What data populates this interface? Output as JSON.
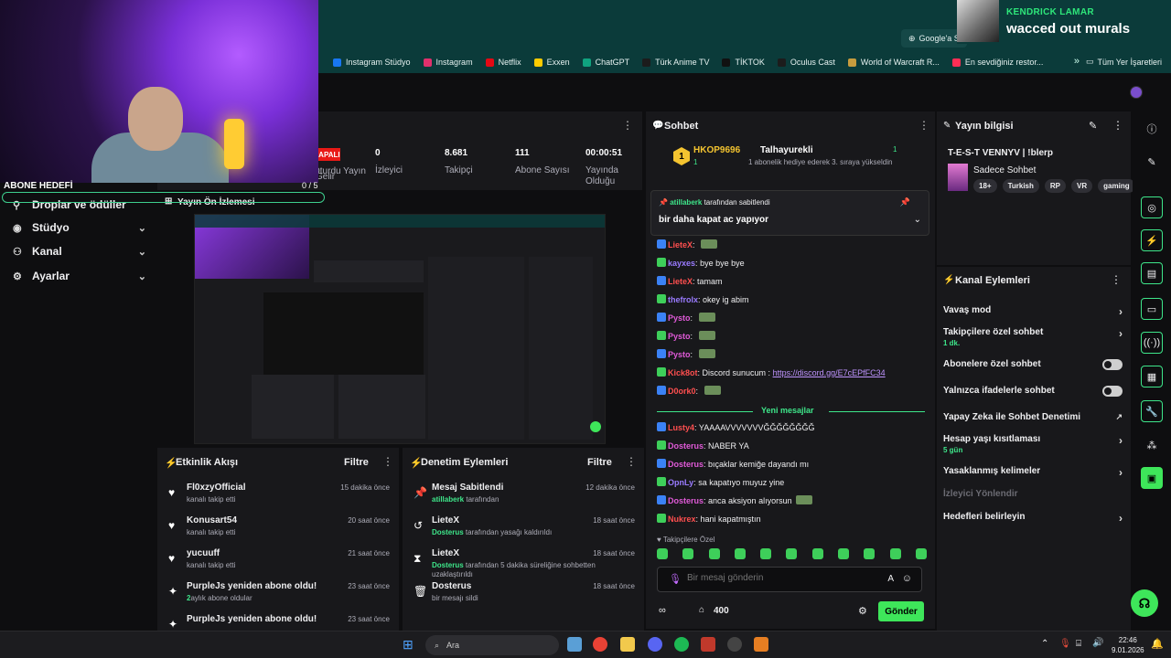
{
  "browser": {
    "bookmarks": [
      {
        "label": "Instagram Stüdyo",
        "color": "#1877f2"
      },
      {
        "label": "Instagram",
        "color": "#e1306c"
      },
      {
        "label": "Netflix",
        "color": "#e50914"
      },
      {
        "label": "Exxen",
        "color": "#ffcc00"
      },
      {
        "label": "ChatGPT",
        "color": "#10a37f"
      },
      {
        "label": "Türk Anime TV",
        "color": "#1c1c1c"
      },
      {
        "label": "TİKTOK",
        "color": "#111111"
      },
      {
        "label": "Oculus Cast",
        "color": "#1c1c1c"
      },
      {
        "label": "World of Warcraft R...",
        "color": "#c79c3e"
      },
      {
        "label": "En sevdiğiniz restor...",
        "color": "#ff2e55"
      }
    ],
    "more": "»",
    "all_bookmarks": "Tüm Yer İşaretleri",
    "google_pill": "Google'a S"
  },
  "now_playing": {
    "artist": "KENDRICK LAMAR",
    "track": "wacced out murals"
  },
  "goal": {
    "label": "ABONE HEDEFİ",
    "count": "0 / 5"
  },
  "nav": {
    "drops": "Droplar ve ödüller",
    "preview": "Yayın Ön İzlemesi",
    "items": [
      {
        "label": "Stüdyo"
      },
      {
        "label": "Kanal"
      },
      {
        "label": "Ayarlar"
      }
    ]
  },
  "stats": {
    "live_badge": "KAPALI",
    "cut_label": "Gelir",
    "items": [
      {
        "value": "",
        "label": "Oturdu Yayın"
      },
      {
        "value": "0",
        "label": "İzleyici"
      },
      {
        "value": "8.681",
        "label": "Takipçi"
      },
      {
        "value": "111",
        "label": "Abone Sayısı"
      },
      {
        "value": "00:00:51",
        "label": "Yayında Olduğu"
      }
    ]
  },
  "activity": {
    "title": "Etkinlik Akışı",
    "filter": "Filtre",
    "events": [
      {
        "title": "Fl0xzyOfficial",
        "sub": "kanalı takip etti",
        "time": "15 dakika önce"
      },
      {
        "title": "Konusart54",
        "sub": "kanalı takip etti",
        "time": "20 saat önce"
      },
      {
        "title": "yucuuff",
        "sub": "kanalı takip etti",
        "time": "21 saat önce"
      },
      {
        "title": "PurpleJs yeniden abone oldu!",
        "sub_bold": "2",
        "sub": "aylık abone oldular",
        "time": "23 saat önce"
      },
      {
        "title": "PurpleJs yeniden abone oldu!",
        "sub": "",
        "time": "23 saat önce"
      }
    ]
  },
  "moderation": {
    "title": "Denetim Eylemleri",
    "filter": "Filtre",
    "events": [
      {
        "title": "Mesaj Sabitlendi",
        "actor": "atillaberk",
        "sub": "tarafından",
        "time": "12 dakika önce"
      },
      {
        "title": "LieteX",
        "actor": "Dosterus",
        "sub": "tarafından yasağı kaldırıldı",
        "time": "18 saat önce"
      },
      {
        "title": "LieteX",
        "actor": "Dosterus",
        "sub": "tarafından 5 dakika süreliğine sohbetten uzaklaştırıldı",
        "time": "18 saat önce"
      },
      {
        "title": "Dosterus",
        "actor": "",
        "sub": "bir mesajı sildi",
        "time": "18 saat önce"
      }
    ]
  },
  "chat": {
    "title": "Sohbet",
    "hype": {
      "rank": "1",
      "name": "HKOP9696",
      "name2": "Talhayurekli",
      "num": "1",
      "count": "1",
      "sub": "1 abonelik hediye ederek 3. sıraya yükseldin"
    },
    "pinned_by_user": "atillaberk",
    "pinned_by_rest": "tarafından sabitlendi",
    "pinned_msg": "bir daha kapat ac yapıyor",
    "messages": [
      {
        "user": "LieteX",
        "color": "#ff4f4f",
        "text": "",
        "emote": true
      },
      {
        "user": "kayxes",
        "color": "#9a7bff",
        "text": "bye bye bye"
      },
      {
        "user": "LieteX",
        "color": "#ff4f4f",
        "text": "tamam"
      },
      {
        "user": "thefrolx",
        "color": "#9a7bff",
        "text": "okey ig abim"
      },
      {
        "user": "Pysto",
        "color": "#e05ad8",
        "text": "",
        "emote": true
      },
      {
        "user": "Pysto",
        "color": "#e05ad8",
        "text": "",
        "emote": true
      },
      {
        "user": "Pysto",
        "color": "#e05ad8",
        "text": "",
        "emote": true
      },
      {
        "user": "Kick8ot",
        "color": "#ff4f4f",
        "text": "Discord sunucum : ",
        "link": "https://discord.gg/E7cEPfFC34"
      },
      {
        "user": "D0ork0",
        "color": "#ff4f4f",
        "text": "",
        "emote": true
      }
    ],
    "new_label": "Yeni mesajlar",
    "messages2": [
      {
        "user": "Lusty4",
        "color": "#ff4f4f",
        "text": "YAAAAVVVVVVVĞĞĞĞĞĞĞĞ"
      },
      {
        "user": "Dosterus",
        "color": "#e05ad8",
        "text": "NABER YA"
      },
      {
        "user": "Dosterus",
        "color": "#e05ad8",
        "text": "bıçaklar kemiğe dayandı mı"
      },
      {
        "user": "OpnLy",
        "color": "#9a7bff",
        "text": "sa kapatıyo muyuz yine"
      },
      {
        "user": "Dosterus",
        "color": "#e05ad8",
        "text": "anca aksiyon alıyorsun",
        "emote": true
      },
      {
        "user": "Nukrex",
        "color": "#ff4f4f",
        "text": "hani kapatmıştın"
      }
    ],
    "followers_only": "Takipçilere Özel",
    "input_placeholder": "Bir mesaj gönderin",
    "points": "400",
    "send": "Gönder"
  },
  "info": {
    "title": "Yayın bilgisi",
    "stream_title": "T-E-S-T  VENNYV | !blerp",
    "category": "Sadece Sohbet",
    "tags": [
      "18+",
      "Turkish",
      "RP",
      "VR",
      "gaming"
    ]
  },
  "actions": {
    "title": "Kanal Eylemleri",
    "items": [
      {
        "label": "Vavaş mod",
        "type": "chev"
      },
      {
        "label": "Takipçilere özel sohbet",
        "sub": "1 dk.",
        "type": "chev"
      },
      {
        "label": "Abonelere özel sohbet",
        "type": "toggle"
      },
      {
        "label": "Yalnızca ifadelerle sohbet",
        "type": "toggle"
      },
      {
        "label": "Yapay Zeka ile Sohbet Denetimi",
        "type": "ext"
      },
      {
        "label": "Hesap yaşı kısıtlaması",
        "sub": "5 gün",
        "type": "chev"
      },
      {
        "label": "Yasaklanmış kelimeler",
        "type": "chev"
      },
      {
        "label": "İzleyici Yönlendir",
        "type": "disabled"
      },
      {
        "label": "Hedefleri belirleyin",
        "type": "chev"
      }
    ]
  },
  "taskbar": {
    "search": "Ara",
    "time": "22:46",
    "date": "9.01.2026"
  }
}
